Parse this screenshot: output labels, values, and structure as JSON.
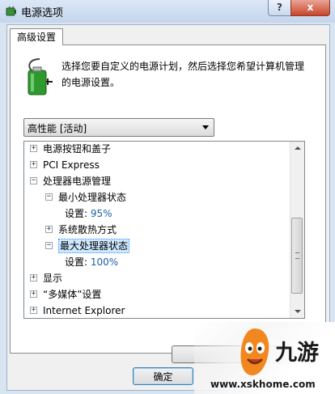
{
  "window": {
    "title": "电源选项",
    "help_label": "?",
    "close_label": "x"
  },
  "tab": {
    "label": "高级设置"
  },
  "description": "选择您要自定义的电源计划，然后选择您希望计算机管理的电源设置。",
  "plan_select": {
    "value": "高性能 [活动]"
  },
  "tree": {
    "items": [
      {
        "label": "电源按钮和盖子",
        "expander": "+",
        "level": 0,
        "selected": false
      },
      {
        "label": "PCI Express",
        "expander": "+",
        "level": 0,
        "selected": false
      },
      {
        "label": "处理器电源管理",
        "expander": "−",
        "level": 0,
        "selected": false
      },
      {
        "label": "最小处理器状态",
        "expander": "−",
        "level": 1,
        "selected": false
      },
      {
        "label": "设置: ",
        "value": "95%",
        "level": 2,
        "selected": false
      },
      {
        "label": "系统散热方式",
        "expander": "+",
        "level": 1,
        "selected": false
      },
      {
        "label": "最大处理器状态",
        "expander": "−",
        "level": 1,
        "selected": true
      },
      {
        "label": "设置: ",
        "value": "100%",
        "level": 2,
        "selected": false
      },
      {
        "label": "显示",
        "expander": "+",
        "level": 0,
        "selected": false
      },
      {
        "label": "“多媒体”设置",
        "expander": "+",
        "level": 0,
        "selected": false
      },
      {
        "label": "Internet Explorer",
        "expander": "+",
        "level": 0,
        "selected": false
      }
    ]
  },
  "buttons": {
    "ok_label": "确定"
  },
  "watermark": {
    "logo_text": "九游",
    "url": "www.xskhome.com"
  },
  "colors": {
    "selection_bg": "#cde8ff",
    "setting_value": "#1f5fa8",
    "close_button": "#c8452c"
  }
}
